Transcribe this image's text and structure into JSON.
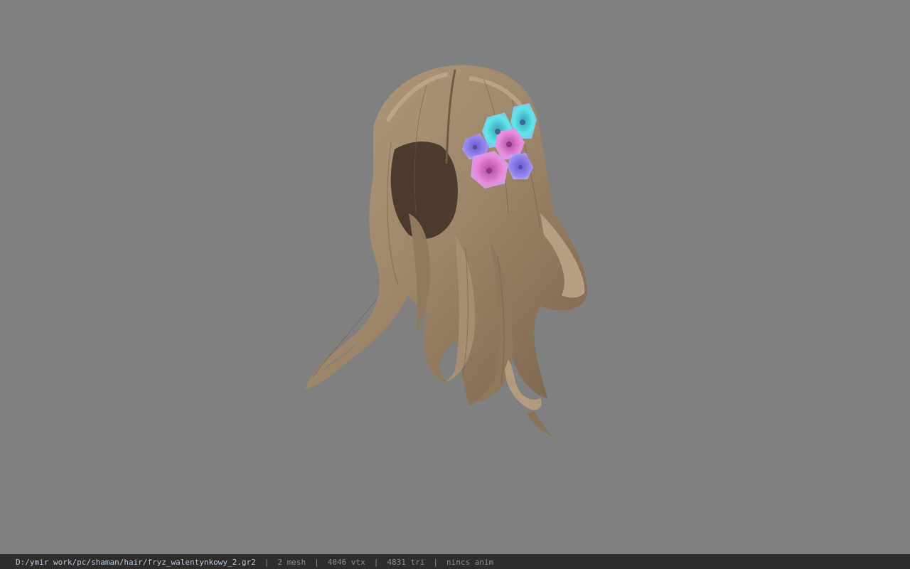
{
  "viewport": {
    "background_color": "#808080",
    "model": {
      "hair_color": "#a48d70",
      "hair_highlight": "#c2aa8a",
      "hair_shadow": "#5e4c3a",
      "flower_colors": [
        "#5ee6e6",
        "#e88ad8",
        "#9a8cf0",
        "#c07ae0"
      ]
    }
  },
  "status_bar": {
    "file_path": "D:/ymir work/pc/shaman/hair/fryz_walentynkowy_2.gr2",
    "separator": "|",
    "mesh_count": "2 mesh",
    "vertex_count": "4046 vtx",
    "triangle_count": "4831 tri",
    "anim_status": "nincs anim"
  }
}
